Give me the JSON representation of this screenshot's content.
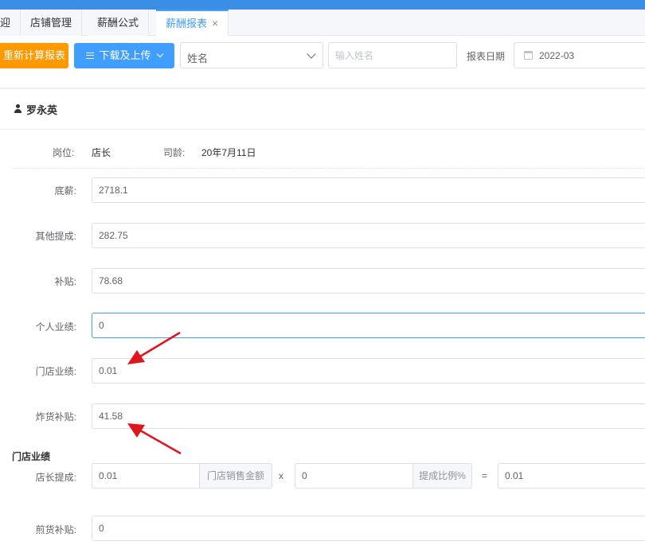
{
  "tabs": [
    {
      "label": "迎"
    },
    {
      "label": "店铺管理"
    },
    {
      "label": "薪酬公式"
    },
    {
      "label": "薪酬报表",
      "close": "×"
    }
  ],
  "toolbar": {
    "recalc_label": "重新计算报表",
    "download_label": "下载及上传",
    "name_select_value": "姓名",
    "name_input_placeholder": "输入姓名",
    "date_label": "报表日期",
    "date_value": "2022-03"
  },
  "user": {
    "name": "罗永英"
  },
  "info": {
    "position_label": "岗位:",
    "position_value": "店长",
    "tenure_label": "司龄:",
    "tenure_value": "20年7月11日"
  },
  "fields": [
    {
      "label": "底薪:",
      "value": "2718.1"
    },
    {
      "label": "其他提成:",
      "value": "282.75"
    },
    {
      "label": "补贴:",
      "value": "78.68"
    },
    {
      "label": "个人业绩:",
      "value": "0"
    },
    {
      "label": "门店业绩:",
      "value": "0.01"
    },
    {
      "label": "炸货补贴:",
      "value": "41.58"
    }
  ],
  "store_section": {
    "title": "门店业绩",
    "label": "店长提成:",
    "input1_value": "0.01",
    "append1": "门店销售金额",
    "op_multiply": "x",
    "input2_value": "0",
    "append2": "提成比例%",
    "op_equals": "=",
    "result_value": "0.01"
  },
  "last_field": {
    "label": "煎货补贴:",
    "value": "0"
  },
  "colors": {
    "accent": "#409eff",
    "orange": "#ff9900",
    "arrow": "#e0161e"
  }
}
